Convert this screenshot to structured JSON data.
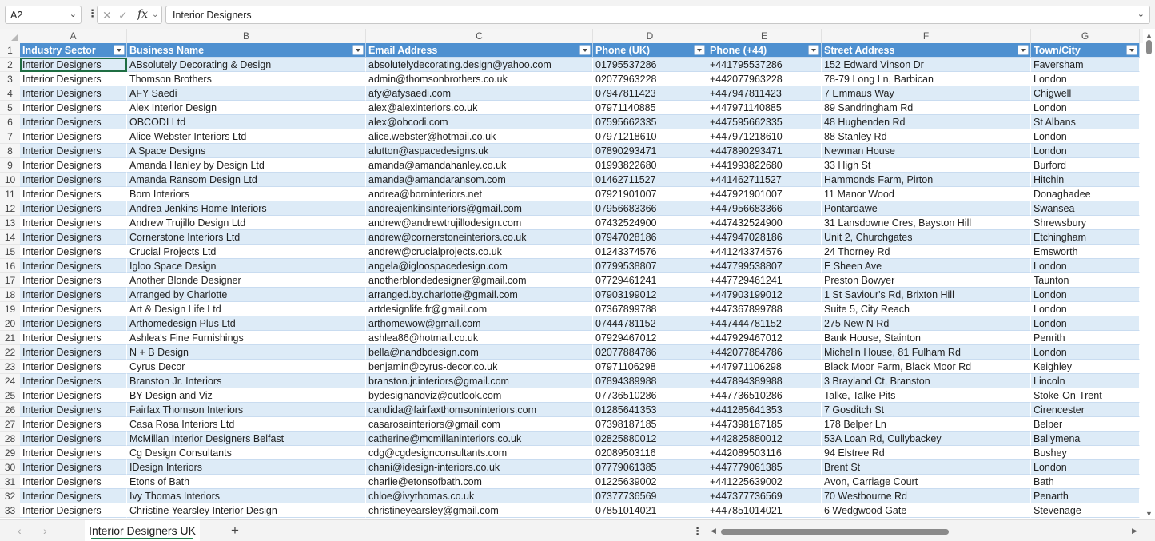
{
  "formula_bar": {
    "name_box": "A2",
    "formula": "Interior Designers",
    "fx_label": "fx"
  },
  "columns": [
    {
      "letter": "A",
      "header": "Industry Sector"
    },
    {
      "letter": "B",
      "header": "Business Name"
    },
    {
      "letter": "C",
      "header": "Email Address"
    },
    {
      "letter": "D",
      "header": "Phone (UK)"
    },
    {
      "letter": "E",
      "header": "Phone (+44)"
    },
    {
      "letter": "F",
      "header": "Street Address"
    },
    {
      "letter": "G",
      "header": "Town/City"
    }
  ],
  "header_row_number": "1",
  "rows": [
    {
      "n": "2",
      "c": [
        "Interior Designers",
        "ABsolutely Decorating & Design",
        "absolutelydecorating.design@yahoo.com",
        "01795537286",
        "+441795537286",
        "152 Edward Vinson Dr",
        "Faversham"
      ]
    },
    {
      "n": "3",
      "c": [
        "Interior Designers",
        "Thomson Brothers",
        "admin@thomsonbrothers.co.uk",
        "02077963228",
        "+442077963228",
        "78-79 Long Ln, Barbican",
        "London"
      ]
    },
    {
      "n": "4",
      "c": [
        "Interior Designers",
        "AFY Saedi",
        "afy@afysaedi.com",
        "07947811423",
        "+447947811423",
        "7 Emmaus Way",
        "Chigwell"
      ]
    },
    {
      "n": "5",
      "c": [
        "Interior Designers",
        "Alex Interior Design",
        "alex@alexinteriors.co.uk",
        "07971140885",
        "+447971140885",
        "89 Sandringham Rd",
        "London"
      ]
    },
    {
      "n": "6",
      "c": [
        "Interior Designers",
        "OBCODI Ltd",
        "alex@obcodi.com",
        "07595662335",
        "+447595662335",
        "48 Hughenden Rd",
        "St Albans"
      ]
    },
    {
      "n": "7",
      "c": [
        "Interior Designers",
        "Alice Webster Interiors Ltd",
        "alice.webster@hotmail.co.uk",
        "07971218610",
        "+447971218610",
        "88 Stanley Rd",
        "London"
      ]
    },
    {
      "n": "8",
      "c": [
        "Interior Designers",
        "A Space Designs",
        "alutton@aspacedesigns.uk",
        "07890293471",
        "+447890293471",
        "Newman House",
        "London"
      ]
    },
    {
      "n": "9",
      "c": [
        "Interior Designers",
        "Amanda Hanley by Design Ltd",
        "amanda@amandahanley.co.uk",
        "01993822680",
        "+441993822680",
        "33 High St",
        "Burford"
      ]
    },
    {
      "n": "10",
      "c": [
        "Interior Designers",
        "Amanda Ransom Design Ltd",
        "amanda@amandaransom.com",
        "01462711527",
        "+441462711527",
        "Hammonds Farm, Pirton",
        "Hitchin"
      ]
    },
    {
      "n": "11",
      "c": [
        "Interior Designers",
        "Born Interiors",
        "andrea@borninteriors.net",
        "07921901007",
        "+447921901007",
        "11 Manor Wood",
        "Donaghadee"
      ]
    },
    {
      "n": "12",
      "c": [
        "Interior Designers",
        "Andrea Jenkins Home Interiors",
        "andreajenkinsinteriors@gmail.com",
        "07956683366",
        "+447956683366",
        "Pontardawe",
        "Swansea"
      ]
    },
    {
      "n": "13",
      "c": [
        "Interior Designers",
        "Andrew Trujillo Design Ltd",
        "andrew@andrewtrujillodesign.com",
        "07432524900",
        "+447432524900",
        "31 Lansdowne Cres, Bayston Hill",
        "Shrewsbury"
      ]
    },
    {
      "n": "14",
      "c": [
        "Interior Designers",
        "Cornerstone Interiors Ltd",
        "andrew@cornerstoneinteriors.co.uk",
        "07947028186",
        "+447947028186",
        "Unit 2, Churchgates",
        "Etchingham"
      ]
    },
    {
      "n": "15",
      "c": [
        "Interior Designers",
        "Crucial Projects Ltd",
        "andrew@crucialprojects.co.uk",
        "01243374576",
        "+441243374576",
        "24 Thorney Rd",
        "Emsworth"
      ]
    },
    {
      "n": "16",
      "c": [
        "Interior Designers",
        "Igloo Space Design",
        "angela@igloospacedesign.com",
        "07799538807",
        "+447799538807",
        "E Sheen Ave",
        "London"
      ]
    },
    {
      "n": "17",
      "c": [
        "Interior Designers",
        "Another Blonde Designer",
        "anotherblondedesigner@gmail.com",
        "07729461241",
        "+447729461241",
        "Preston Bowyer",
        "Taunton"
      ]
    },
    {
      "n": "18",
      "c": [
        "Interior Designers",
        "Arranged by Charlotte",
        "arranged.by.charlotte@gmail.com",
        "07903199012",
        "+447903199012",
        "1 St Saviour's Rd, Brixton Hill",
        "London"
      ]
    },
    {
      "n": "19",
      "c": [
        "Interior Designers",
        "Art & Design Life Ltd",
        "artdesignlife.fr@gmail.com",
        "07367899788",
        "+447367899788",
        "Suite 5, City Reach",
        "London"
      ]
    },
    {
      "n": "20",
      "c": [
        "Interior Designers",
        "Arthomedesign Plus Ltd",
        "arthomewow@gmail.com",
        "07444781152",
        "+447444781152",
        "275 New N Rd",
        "London"
      ]
    },
    {
      "n": "21",
      "c": [
        "Interior Designers",
        "Ashlea's Fine Furnishings",
        "ashlea86@hotmail.co.uk",
        "07929467012",
        "+447929467012",
        "Bank House, Stainton",
        "Penrith"
      ]
    },
    {
      "n": "22",
      "c": [
        "Interior Designers",
        "N + B Design",
        "bella@nandbdesign.com",
        "02077884786",
        "+442077884786",
        "Michelin House, 81 Fulham Rd",
        "London"
      ]
    },
    {
      "n": "23",
      "c": [
        "Interior Designers",
        "Cyrus Decor",
        "benjamin@cyrus-decor.co.uk",
        "07971106298",
        "+447971106298",
        "Black Moor Farm, Black Moor Rd",
        "Keighley"
      ]
    },
    {
      "n": "24",
      "c": [
        "Interior Designers",
        "Branston Jr. Interiors",
        "branston.jr.interiors@gmail.com",
        "07894389988",
        "+447894389988",
        "3 Brayland Ct, Branston",
        "Lincoln"
      ]
    },
    {
      "n": "25",
      "c": [
        "Interior Designers",
        "BY Design and Viz",
        "bydesignandviz@outlook.com",
        "07736510286",
        "+447736510286",
        "Talke, Talke Pits",
        "Stoke-On-Trent"
      ]
    },
    {
      "n": "26",
      "c": [
        "Interior Designers",
        "Fairfax Thomson Interiors",
        "candida@fairfaxthomsoninteriors.com",
        "01285641353",
        "+441285641353",
        "7 Gosditch St",
        "Cirencester"
      ]
    },
    {
      "n": "27",
      "c": [
        "Interior Designers",
        "Casa Rosa Interiors Ltd",
        "casarosainteriors@gmail.com",
        "07398187185",
        "+447398187185",
        "178 Belper Ln",
        "Belper"
      ]
    },
    {
      "n": "28",
      "c": [
        "Interior Designers",
        "McMillan Interior Designers Belfast",
        "catherine@mcmillaninteriors.co.uk",
        "02825880012",
        "+442825880012",
        "53A Loan Rd, Cullybackey",
        "Ballymena"
      ]
    },
    {
      "n": "29",
      "c": [
        "Interior Designers",
        "Cg Design Consultants",
        "cdg@cgdesignconsultants.com",
        "02089503116",
        "+442089503116",
        "94 Elstree Rd",
        "Bushey"
      ]
    },
    {
      "n": "30",
      "c": [
        "Interior Designers",
        "IDesign Interiors",
        "chani@idesign-interiors.co.uk",
        "07779061385",
        "+447779061385",
        "Brent St",
        "London"
      ]
    },
    {
      "n": "31",
      "c": [
        "Interior Designers",
        "Etons of Bath",
        "charlie@etonsofbath.com",
        "01225639002",
        "+441225639002",
        "Avon, Carriage Court",
        "Bath"
      ]
    },
    {
      "n": "32",
      "c": [
        "Interior Designers",
        "Ivy Thomas Interiors",
        "chloe@ivythomas.co.uk",
        "07377736569",
        "+447377736569",
        "70 Westbourne Rd",
        "Penarth"
      ]
    },
    {
      "n": "33",
      "c": [
        "Interior Designers",
        "Christine Yearsley Interior Design",
        "christineyearsley@gmail.com",
        "07851014021",
        "+447851014021",
        "6 Wedgwood Gate",
        "Stevenage"
      ]
    }
  ],
  "sheet_tabs": [
    {
      "label": "Interior Designers UK",
      "active": true
    }
  ],
  "icons": {
    "namebox_dropdown": "chevron-down-icon",
    "cancel": "close-icon",
    "enter": "check-icon",
    "function": "fx-icon",
    "add_sheet": "plus-icon"
  },
  "colors": {
    "header_fill": "#4e90d0",
    "band_fill": "#ddebf7",
    "active_tab_underline": "#1f7c4d"
  }
}
